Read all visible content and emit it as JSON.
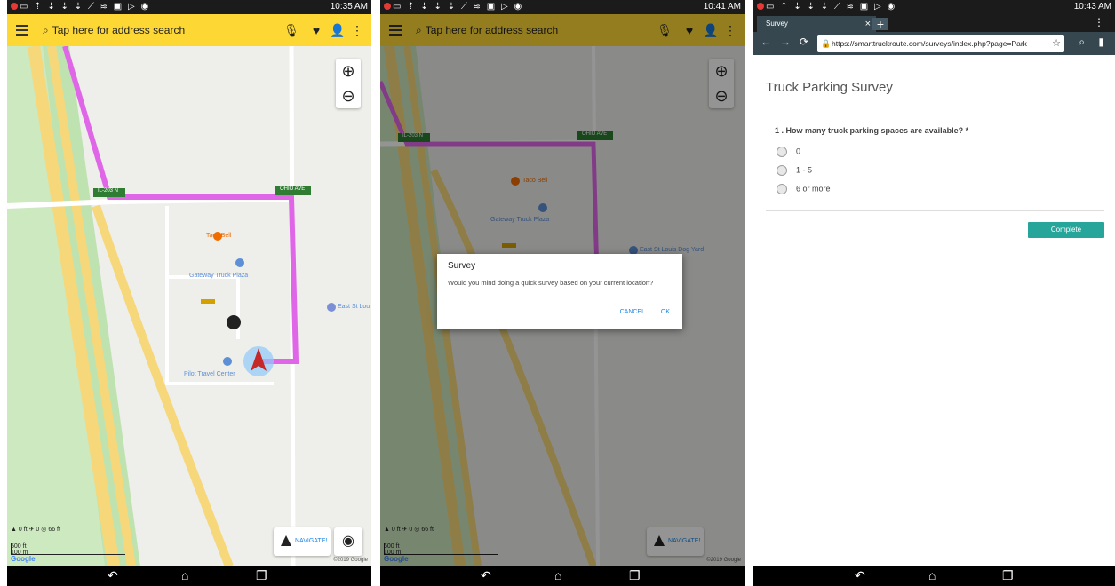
{
  "screens": {
    "s1": {
      "status_time": "10:35 AM",
      "search_placeholder": "Tap here for address search",
      "map_labels": {
        "taco_bell": "Taco Bell",
        "gateway": "Gateway Truck Plaza",
        "pilot": "Pilot Travel Center",
        "east_st_lou": "East St Lou",
        "il203": "IL-203 N",
        "ohio_ave": "OHIO AVE"
      },
      "stats": {
        "elevation": "0 ft",
        "grade": "0",
        "distance": "66 ft"
      },
      "scale": {
        "ft": "500 ft",
        "m": "100 m"
      },
      "google": "Google",
      "copyright": "©2019 Google",
      "navigate_label": "NAVIGATE!"
    },
    "s2": {
      "status_time": "10:41 AM",
      "search_placeholder": "Tap here for address search",
      "map_labels": {
        "taco_bell": "Taco Bell",
        "gateway": "Gateway Truck Plaza",
        "east_st_louis": "East St Louis Dog Yard",
        "il203": "IL-203 N",
        "ohio_ave": "OHIO AVE"
      },
      "stats": {
        "elevation": "0 ft",
        "grade": "0",
        "distance": "66 ft"
      },
      "scale": {
        "ft": "500 ft",
        "m": "100 m"
      },
      "google": "Google",
      "copyright": "©2019 Google",
      "navigate_label": "NAVIGATE!",
      "dialog": {
        "title": "Survey",
        "message": "Would you mind doing a quick survey based on your current location?",
        "cancel": "CANCEL",
        "ok": "OK"
      }
    },
    "s3": {
      "status_time": "10:43 AM",
      "tab_title": "Survey",
      "url": "https://smarttruckroute.com/surveys/index.php?page=Park",
      "page_title": "Truck Parking Survey",
      "question": "1 .  How many truck parking spaces are available? *",
      "options": [
        "0",
        "1 - 5",
        "6 or more"
      ],
      "complete_label": "Complete"
    }
  },
  "colors": {
    "toolbar": "#fdd835",
    "route": "#e066e8",
    "accent": "#26a69a"
  }
}
